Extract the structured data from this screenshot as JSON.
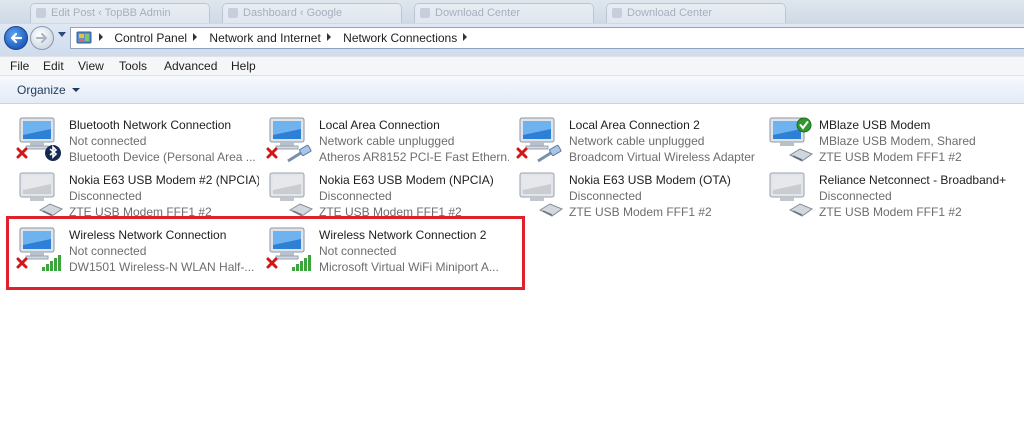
{
  "browser_tabs": [
    "Edit Post ‹ TopBB Admin",
    "Dashboard ‹ Google",
    "Download Center",
    "Download Center"
  ],
  "address": {
    "breadcrumbs": [
      "Control Panel",
      "Network and Internet",
      "Network Connections"
    ]
  },
  "menu": [
    "File",
    "Edit",
    "View",
    "Tools",
    "Advanced",
    "Help"
  ],
  "toolbar": {
    "organize_label": "Organize"
  },
  "connections": [
    {
      "name": "Bluetooth Network Connection",
      "status": "Not connected",
      "device": "Bluetooth Device (Personal Area ...",
      "icon": "bluetooth-network-icon",
      "badge": "red-x"
    },
    {
      "name": "Local Area Connection",
      "status": "Network cable unplugged",
      "device": "Atheros AR8152 PCI-E Fast Ethern...",
      "icon": "ethernet-network-icon",
      "badge": "red-x"
    },
    {
      "name": "Local Area Connection 2",
      "status": "Network cable unplugged",
      "device": "Broadcom Virtual Wireless Adapter",
      "icon": "ethernet-network-icon",
      "badge": "red-x"
    },
    {
      "name": "MBlaze USB Modem",
      "status": "MBlaze USB Modem, Shared",
      "device": "ZTE USB Modem FFF1 #2",
      "icon": "modem-network-icon",
      "badge": "green-check"
    },
    {
      "name": "Nokia E63 USB Modem #2 (NPCIA)",
      "status": "Disconnected",
      "device": "ZTE USB Modem FFF1 #2",
      "icon": "modem-network-icon",
      "badge": "none"
    },
    {
      "name": "Nokia E63 USB Modem (NPCIA)",
      "status": "Disconnected",
      "device": "ZTE USB Modem FFF1 #2",
      "icon": "modem-network-icon",
      "badge": "none"
    },
    {
      "name": "Nokia E63 USB Modem (OTA)",
      "status": "Disconnected",
      "device": "ZTE USB Modem FFF1 #2",
      "icon": "modem-network-icon",
      "badge": "none"
    },
    {
      "name": "Reliance Netconnect - Broadband+",
      "status": "Disconnected",
      "device": "ZTE USB Modem FFF1 #2",
      "icon": "modem-network-icon",
      "badge": "none"
    },
    {
      "name": "Wireless Network Connection",
      "status": "Not connected",
      "device": "DW1501 Wireless-N WLAN Half-...",
      "icon": "wireless-network-icon",
      "badge": "red-x"
    },
    {
      "name": "Wireless Network Connection 2",
      "status": "Not connected",
      "device": "Microsoft Virtual WiFi Miniport A...",
      "icon": "wireless-network-icon",
      "badge": "red-x"
    }
  ],
  "colors": {
    "highlight_border": "#e0202a",
    "secondary_text": "#6d6d6d",
    "status_green": "#2e9a2e",
    "status_red": "#d01818"
  }
}
